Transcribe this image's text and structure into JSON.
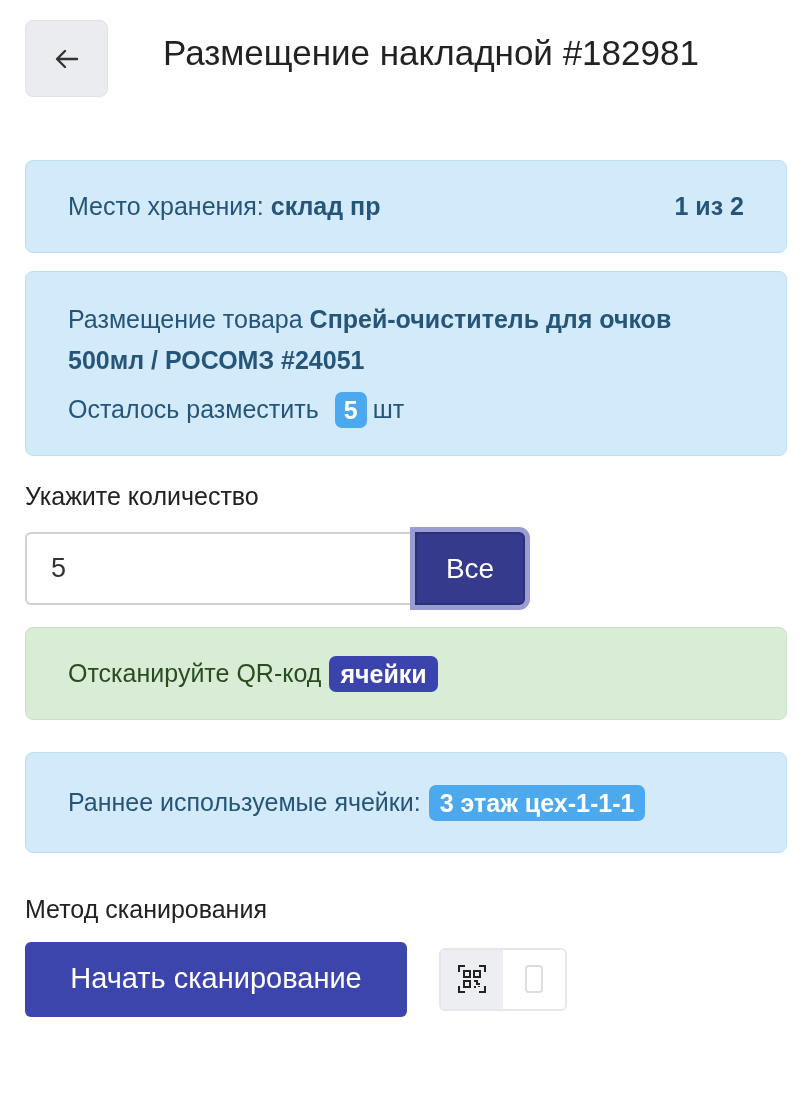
{
  "header": {
    "title": "Размещение накладной #182981"
  },
  "storage": {
    "label": "Место хранения:",
    "value": "склад пр",
    "counter": "1 из 2"
  },
  "product": {
    "text": "Размещение товара **Спрей-очиститель для очков 500мл / РОСОМЗ #24051**",
    "remaining_label": "Осталось разместить",
    "remaining_count": "5",
    "unit": "шт"
  },
  "quantity": {
    "label": "Укажите количество",
    "value": "5",
    "button": "Все",
    "button_focused": true
  },
  "scan_prompt": {
    "text": "Отсканируйте QR-код",
    "badge": "ячейки"
  },
  "recent_cells": {
    "label": "Раннее используемые ячейки:",
    "badge": "3 этаж цех-1-1-1"
  },
  "scan_method": {
    "label": "Метод сканирования",
    "button": "Начать сканирование",
    "modes": [
      {
        "kind": "qr",
        "selected": true
      },
      {
        "kind": "phone",
        "selected": false
      }
    ]
  }
}
